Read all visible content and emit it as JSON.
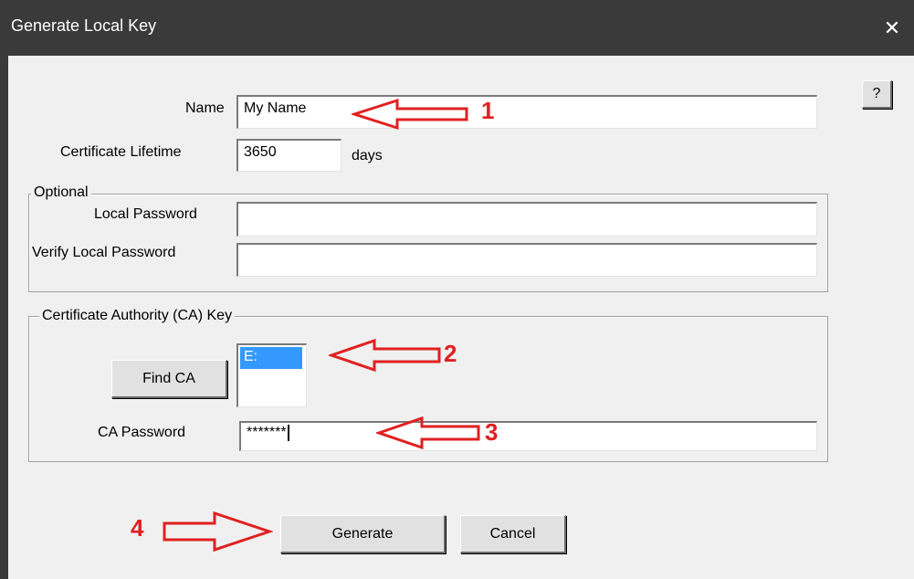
{
  "window": {
    "title": "Generate Local Key"
  },
  "help_button": "?",
  "fields": {
    "name": {
      "label": "Name",
      "value": "My Name"
    },
    "lifetime": {
      "label": "Certificate Lifetime",
      "value": "3650",
      "unit": "days"
    }
  },
  "optional": {
    "legend": "Optional",
    "local_password": {
      "label": "Local Password",
      "value": ""
    },
    "verify_password": {
      "label": "Verify Local Password",
      "value": ""
    }
  },
  "ca": {
    "legend": "Certificate Authority (CA) Key",
    "find_button": "Find CA",
    "drive_list": [
      "E:"
    ],
    "password": {
      "label": "CA Password",
      "value": "*******"
    }
  },
  "buttons": {
    "generate": "Generate",
    "cancel": "Cancel"
  },
  "annotations": [
    "1",
    "2",
    "3",
    "4"
  ],
  "colors": {
    "titlebar": "#3a3a3a",
    "annotation": "#e02020",
    "selection": "#3399ff"
  }
}
